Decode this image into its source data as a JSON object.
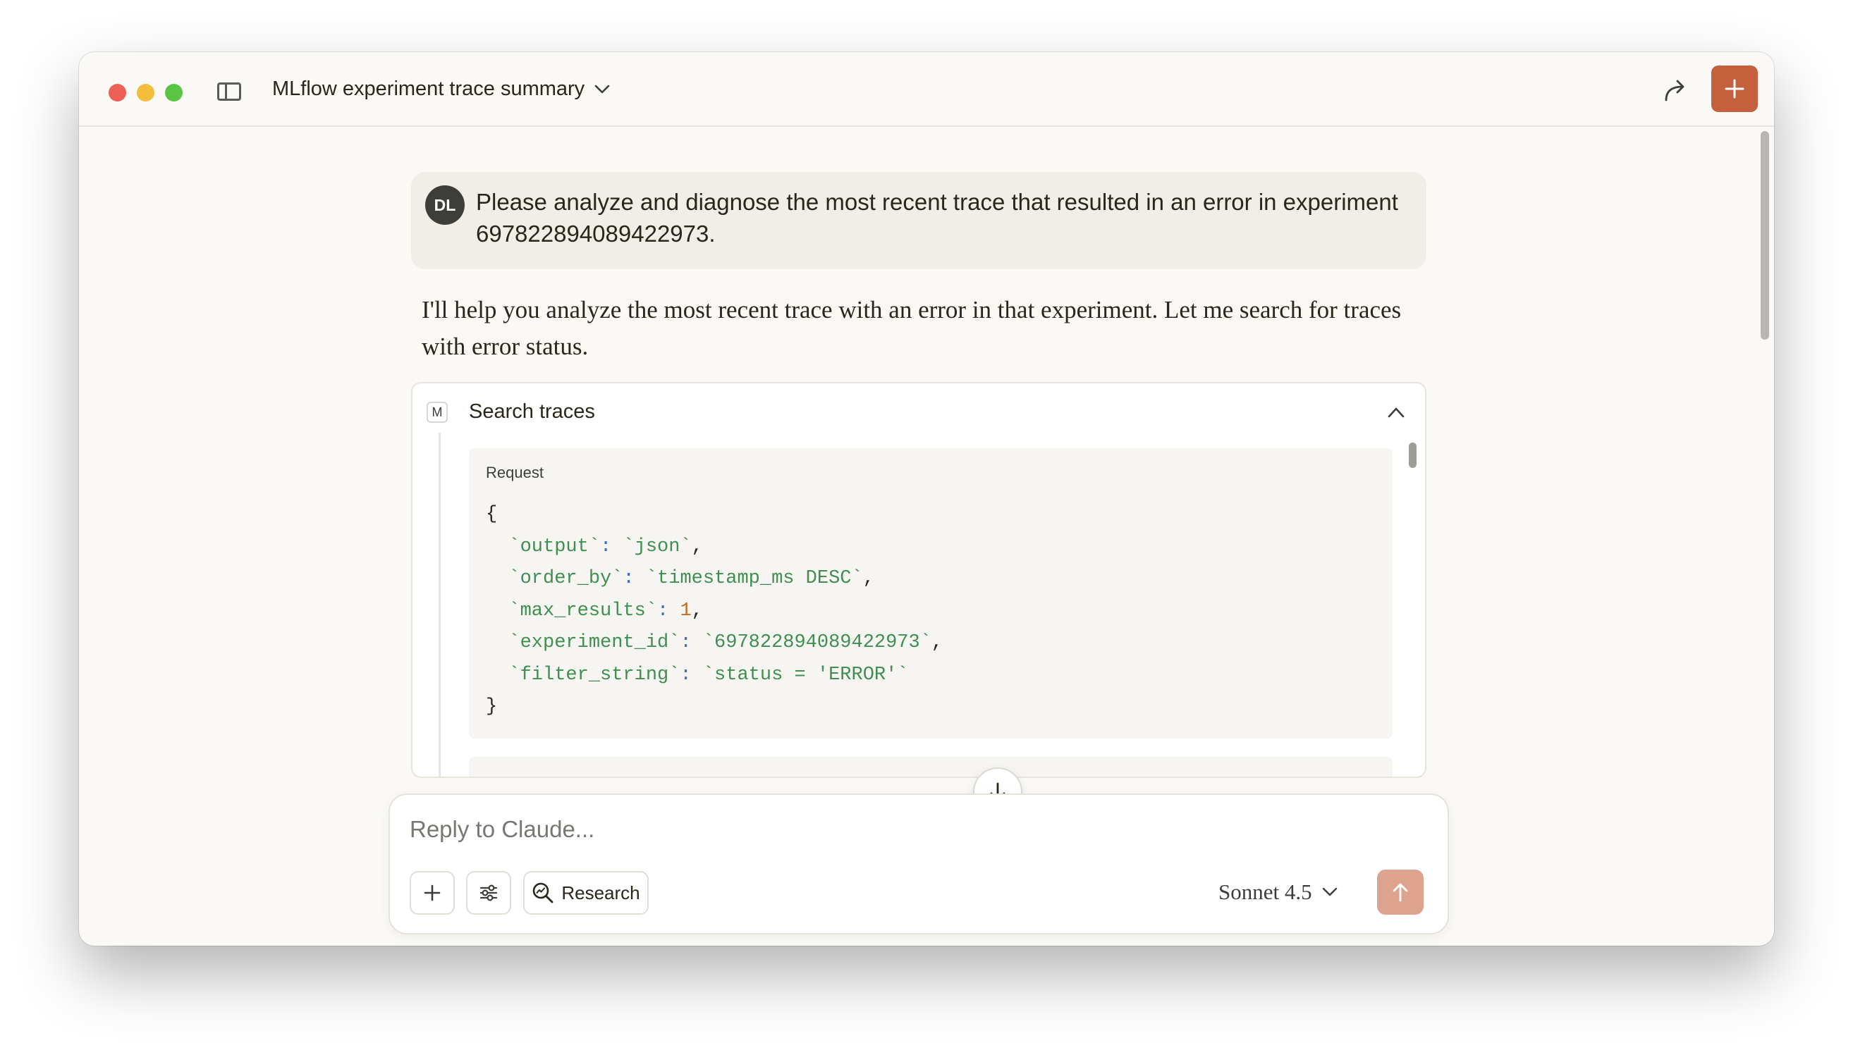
{
  "window": {
    "title": "MLflow experiment trace summary"
  },
  "user_message": {
    "avatar_initials": "DL",
    "text": "Please analyze and diagnose the most recent trace that resulted in an error in experiment 697822894089422973."
  },
  "assistant_message": {
    "text": "I'll help you analyze the most recent trace with an error in that experiment. Let me search for traces with error status."
  },
  "tool_call": {
    "badge": "M",
    "title": "Search traces",
    "request_label": "Request",
    "request": [
      {
        "key": "output",
        "value": "json",
        "type": "string"
      },
      {
        "key": "order_by",
        "value": "timestamp_ms DESC",
        "type": "string"
      },
      {
        "key": "max_results",
        "value": "1",
        "type": "number"
      },
      {
        "key": "experiment_id",
        "value": "697822894089422973",
        "type": "string"
      },
      {
        "key": "filter_string",
        "value": "status = 'ERROR'",
        "type": "string"
      }
    ]
  },
  "composer": {
    "placeholder": "Reply to Claude...",
    "research_label": "Research",
    "model": "Sonnet 4.5"
  },
  "colors": {
    "accent": "#c4613c",
    "send_disabled": "#dea38e",
    "code_string": "#3f8f52",
    "code_punct": "#2f72c7",
    "code_number": "#c26d24"
  }
}
